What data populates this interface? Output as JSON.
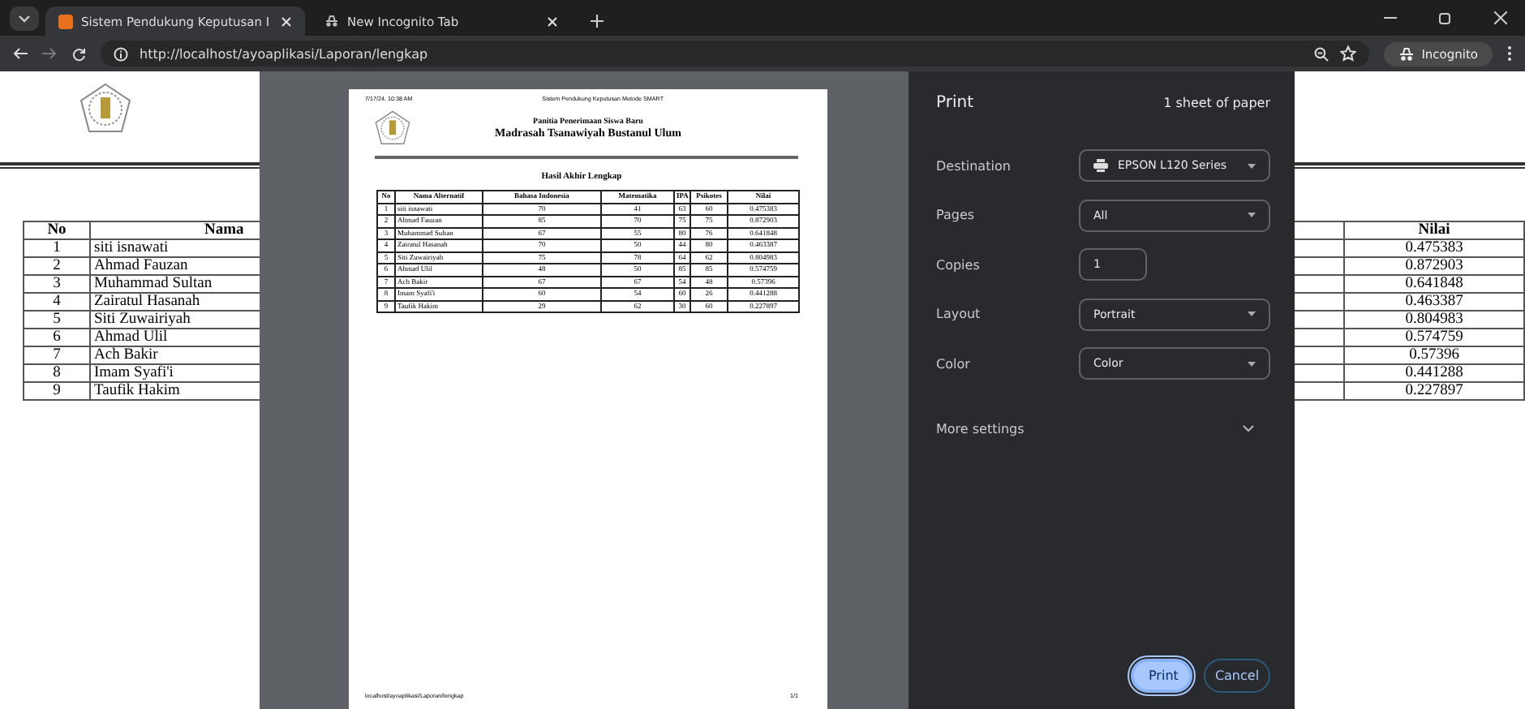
{
  "browser": {
    "tabs": [
      {
        "title": "Sistem Pendukung Keputusan I",
        "selected": true
      },
      {
        "title": "New Incognito Tab",
        "selected": false
      }
    ],
    "url": "http://localhost/ayoaplikasi/Laporan/lengkap",
    "profile": "Incognito"
  },
  "page": {
    "columns": [
      "No",
      "Nama",
      "Nilai"
    ],
    "rows": [
      [
        "1",
        "siti isnawati",
        "0.475383"
      ],
      [
        "2",
        "Ahmad Fauzan",
        "0.872903"
      ],
      [
        "3",
        "Muhammad Sultan",
        "0.641848"
      ],
      [
        "4",
        "Zairatul Hasanah",
        "0.463387"
      ],
      [
        "5",
        "Siti Zuwairiyah",
        "0.804983"
      ],
      [
        "6",
        "Ahmad Ulil",
        "0.574759"
      ],
      [
        "7",
        "Ach Bakir",
        "0.57396"
      ],
      [
        "8",
        "Imam Syafi'i",
        "0.441288"
      ],
      [
        "9",
        "Taufik Hakim",
        "0.227897"
      ]
    ]
  },
  "print_preview": {
    "header_date": "7/17/24, 10:38 AM",
    "header_title": "Sistem Pendukung Keputusan Metode SMART",
    "committee": "Panitia Penerimaan Siswa Baru",
    "school": "Madrasah Tsanawiyah Bustanul Ulum",
    "report_title": "Hasil Akhir Lengkap",
    "columns": [
      "No",
      "Nama Alternatif",
      "Bahasa Indonesia",
      "Matematika",
      "IPA",
      "Psikotes",
      "Nilai"
    ],
    "rows": [
      [
        "1",
        "siti isnawati",
        "70",
        "41",
        "63",
        "60",
        "0.475383"
      ],
      [
        "2",
        "Ahmad Fauzan",
        "85",
        "70",
        "75",
        "75",
        "0.872903"
      ],
      [
        "3",
        "Muhammad Sultan",
        "67",
        "55",
        "80",
        "76",
        "0.641848"
      ],
      [
        "4",
        "Zairatul Hasanah",
        "70",
        "50",
        "44",
        "80",
        "0.463387"
      ],
      [
        "5",
        "Siti Zuwairiyah",
        "75",
        "78",
        "64",
        "62",
        "0.804983"
      ],
      [
        "6",
        "Ahmad Ulil",
        "48",
        "50",
        "85",
        "85",
        "0.574759"
      ],
      [
        "7",
        "Ach Bakir",
        "67",
        "67",
        "54",
        "48",
        "0.57396"
      ],
      [
        "8",
        "Imam Syafi'i",
        "60",
        "54",
        "60",
        "26",
        "0.441288"
      ],
      [
        "9",
        "Taufik Hakim",
        "29",
        "62",
        "30",
        "60",
        "0.227897"
      ]
    ],
    "footer_url": "localhost/ayoaplikasi/Laporan/lengkap",
    "page_number": "1/1"
  },
  "print_dialog": {
    "title": "Print",
    "sheets": "1 sheet of paper",
    "settings": [
      {
        "label": "Destination",
        "value": "EPSON L120 Series",
        "kind": "printer"
      },
      {
        "label": "Pages",
        "value": "All",
        "kind": "select"
      },
      {
        "label": "Copies",
        "value": "1",
        "kind": "number"
      },
      {
        "label": "Layout",
        "value": "Portrait",
        "kind": "select"
      },
      {
        "label": "Color",
        "value": "Color",
        "kind": "select"
      }
    ],
    "more_settings": "More settings",
    "buttons": [
      {
        "label": "Print",
        "kind": "primary"
      },
      {
        "label": "Cancel",
        "kind": "secondary"
      }
    ]
  }
}
